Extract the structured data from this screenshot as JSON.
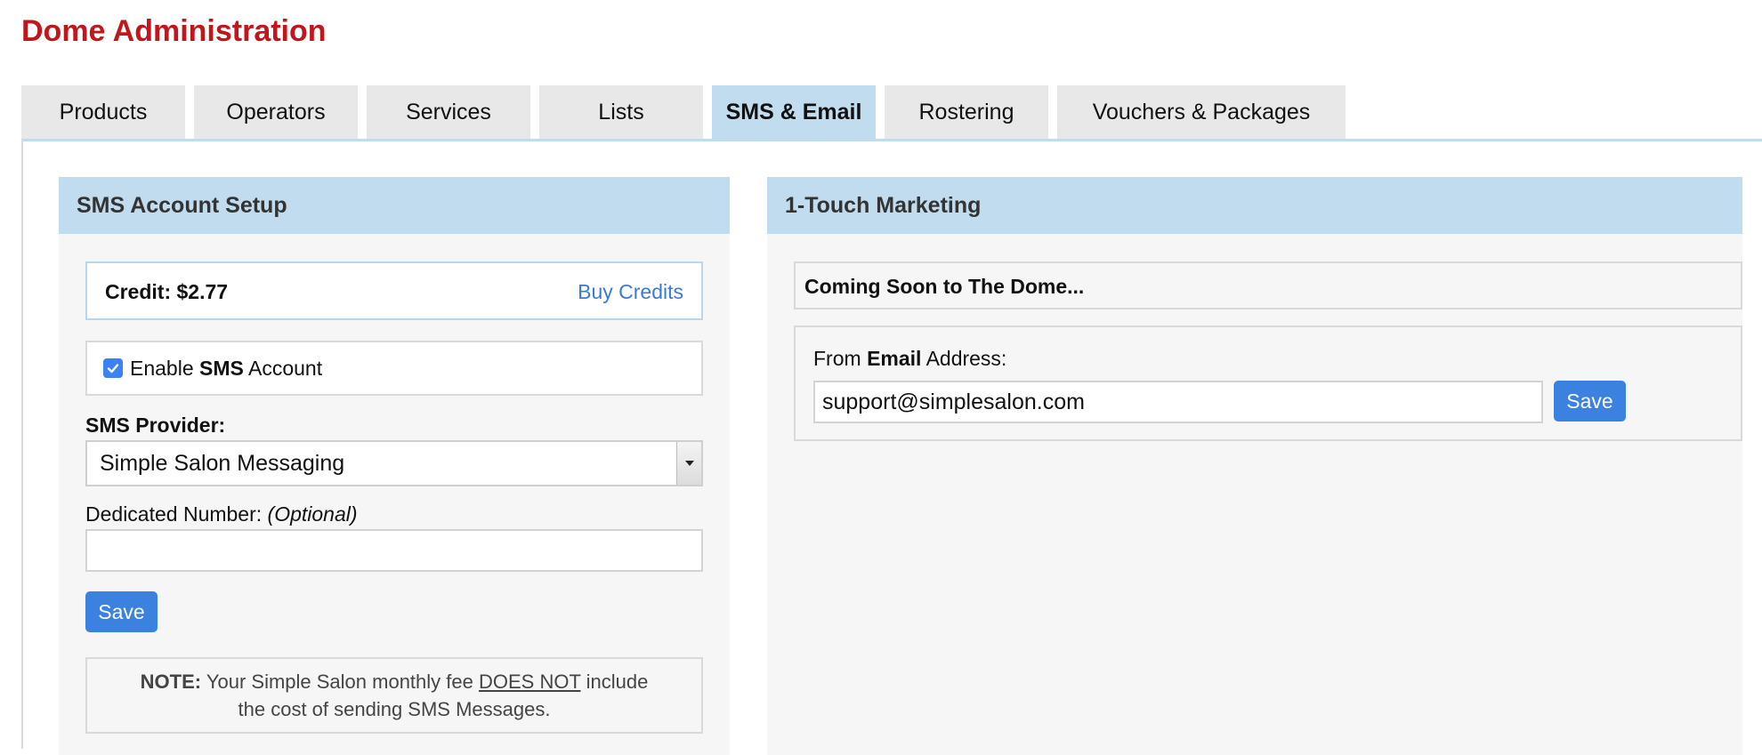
{
  "page": {
    "title": "Dome Administration"
  },
  "tabs": [
    {
      "label": "Products",
      "active": false
    },
    {
      "label": "Operators",
      "active": false
    },
    {
      "label": "Services",
      "active": false
    },
    {
      "label": "Lists",
      "active": false
    },
    {
      "label": "SMS & Email",
      "active": true
    },
    {
      "label": "Rostering",
      "active": false
    },
    {
      "label": "Vouchers & Packages",
      "active": false
    }
  ],
  "sms_panel": {
    "header": "SMS Account Setup",
    "credit_label": "Credit:",
    "credit_value": "$2.77",
    "buy_credits_label": "Buy Credits",
    "enable_prefix": "Enable",
    "enable_bold": "SMS",
    "enable_suffix": "Account",
    "enable_checked": true,
    "provider_label": "SMS Provider:",
    "provider_value": "Simple Salon Messaging",
    "dedicated_label": "Dedicated Number:",
    "dedicated_optional": "(Optional)",
    "dedicated_value": "",
    "save_label": "Save",
    "note_bold": "NOTE:",
    "note_text_1": "Your Simple Salon monthly fee",
    "note_underline": "DOES NOT",
    "note_text_2": "include",
    "note_text_3": "the cost of sending SMS Messages."
  },
  "marketing_panel": {
    "header": "1-Touch Marketing",
    "coming_soon": "Coming Soon to The Dome...",
    "from_prefix": "From",
    "from_bold": "Email",
    "from_suffix": "Address:",
    "email_value": "support@simplesalon.com",
    "save_label": "Save"
  },
  "colors": {
    "title": "#c0161c",
    "tab_active": "#c1dcee",
    "tab_inactive": "#e8e8e8",
    "accent_button": "#3b82e0",
    "link": "#3a7bd5"
  },
  "icons": {
    "enable_checkbox": "check-icon",
    "provider_dropdown": "chevron-down-icon"
  }
}
